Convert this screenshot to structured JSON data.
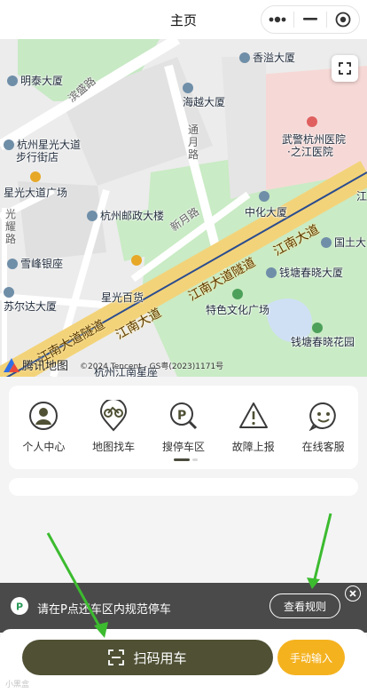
{
  "header": {
    "title": "主页"
  },
  "map": {
    "labels": {
      "mingtai": "明泰大厦",
      "binsheng_road": "滨盛路",
      "xiangyi": "香溢大厦",
      "haiyue": "海越大厦",
      "tongyue_road": "通月路",
      "wujing_hospital": "武警杭州医院",
      "wujing_hospital_2": "·之江医院",
      "xingguang_street": "杭州星光大道",
      "xingguang_street_2": "步行街店",
      "xingguang_plaza": "星光大道广场",
      "guangyao_road": "光耀路",
      "youzheng": "杭州邮政大楼",
      "xinyue_road": "新月路",
      "zhonghua": "中化大厦",
      "jiangnan_tunnel_1": "江南大道隧道",
      "jiangnan_road_1": "江南大道",
      "xuefeng": "雪峰银座",
      "xingguang_mall": "星光百货",
      "guotu": "国土大",
      "qiantang_chunxiao": "钱塘春晓大厦",
      "suerda": "苏尔达大厦",
      "tese_plaza": "特色文化广场",
      "jiangnan_tunnel_2": "江南大道隧道",
      "jiangnan_road_2": "江南大道",
      "qiantang_garden": "钱塘春晓花园",
      "jiangnan_star": "杭州江南星座",
      "jiang_edge": "江"
    },
    "logo_text": "腾讯地图",
    "copyright": "©2024 Tencent - GS粤(2023)1171号"
  },
  "menu": {
    "items": [
      {
        "label": "个人中心",
        "icon": "user-icon"
      },
      {
        "label": "地图找车",
        "icon": "bike-location-icon"
      },
      {
        "label": "搜停车区",
        "icon": "parking-search-icon"
      },
      {
        "label": "故障上报",
        "icon": "warning-icon"
      },
      {
        "label": "在线客服",
        "icon": "chat-service-icon"
      }
    ],
    "page_count": 2,
    "current_page": 1
  },
  "notice": {
    "text": "请在P点还车区内规范停车",
    "rule_button": "查看规则"
  },
  "bottom": {
    "scan_button": "扫码用车",
    "manual_button": "手动输入",
    "watermark": "小黑盒"
  },
  "colors": {
    "scan_button": "#4f5034",
    "manual_button": "#f4b21f",
    "notice_bg": "#4a4a4a",
    "arrow_green": "#3cbb2f"
  }
}
